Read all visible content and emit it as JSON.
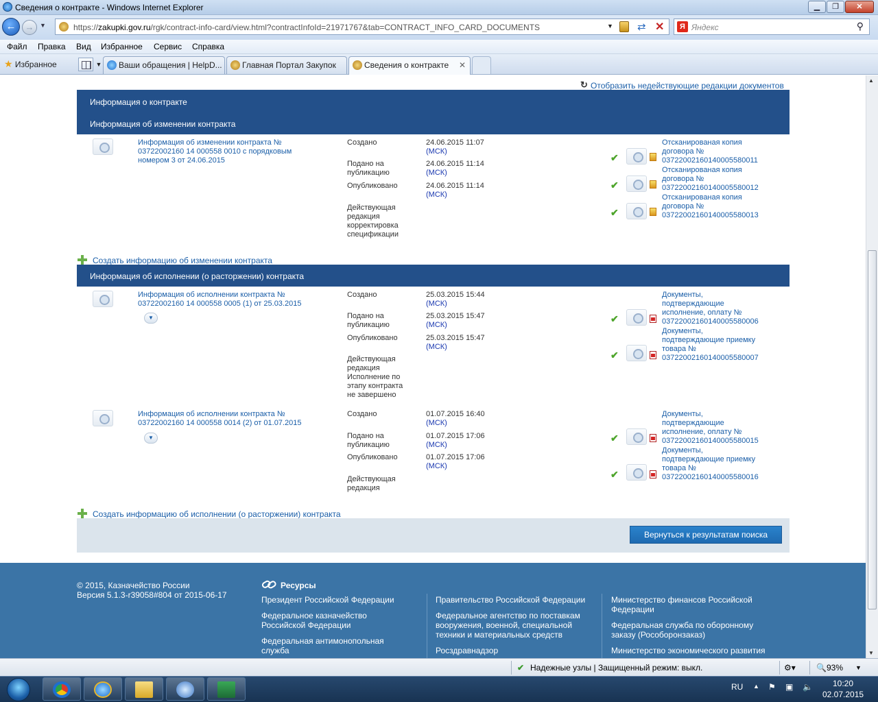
{
  "window": {
    "title": "Сведения о контракте - Windows Internet Explorer"
  },
  "nav": {
    "url_prefix": "https://",
    "url_host": "zakupki.gov.ru",
    "url_path": "/rgk/contract-info-card/view.html?contractInfoId=21971767&tab=CONTRACT_INFO_CARD_DOCUMENTS",
    "search_placeholder": "Яндекс",
    "search_logo": "Я"
  },
  "menu": [
    "Файл",
    "Правка",
    "Вид",
    "Избранное",
    "Сервис",
    "Справка"
  ],
  "favorites_label": "Избранное",
  "tabs": [
    {
      "label": "Ваши обращения | HelpD...",
      "active": false
    },
    {
      "label": "Главная Портал Закупок",
      "active": false
    },
    {
      "label": "Сведения о контракте",
      "active": true
    }
  ],
  "page": {
    "toggle_link": "Отобразить недействующие редакции документов",
    "sections": {
      "contract_info": "Информация о контракте",
      "changes": "Информация об изменении контракта",
      "execution": "Информация об исполнении (о расторжении) контракта"
    },
    "labels": {
      "created": "Создано",
      "submitted_l1": "Подано на",
      "submitted_l2": "публикацию",
      "published": "Опубликовано",
      "tz": "(МСК)"
    },
    "change_entry": {
      "title_l1": "Информация об изменении контракта №",
      "title_l2": "03722002160 14 000558 0010 с порядковым",
      "title_l3": "номером 3 от 24.06.2015",
      "created": "24.06.2015 11:07",
      "submitted": "24.06.2015 11:14",
      "published": "24.06.2015 11:14",
      "status_lines": [
        "Действующая",
        "редакция",
        "корректировка",
        "спецификации"
      ],
      "docs": [
        {
          "l1": "Отсканированая копия",
          "l2": "договора №",
          "l3": "03722002160140005580011"
        },
        {
          "l1": "Отсканированая копия",
          "l2": "договора №",
          "l3": "03722002160140005580012"
        },
        {
          "l1": "Отсканированая копия",
          "l2": "договора №",
          "l3": "03722002160140005580013"
        }
      ]
    },
    "create_change_link": "Создать информацию об изменении контракта",
    "exec_entries": [
      {
        "title_l1": "Информация об исполнении контракта №",
        "title_l2": "03722002160 14 000558 0005 (1) от 25.03.2015",
        "created": "25.03.2015 15:44",
        "submitted": "25.03.2015 15:47",
        "published": "25.03.2015 15:47",
        "status_lines": [
          "Действующая",
          "редакция",
          "Исполнение по",
          "этапу контракта",
          "не завершено"
        ],
        "docs": [
          {
            "l1": "Документы,",
            "l2": "подтверждающие",
            "l3": "исполнение, оплату №",
            "l4": "03722002160140005580006"
          },
          {
            "l1": "Документы,",
            "l2": "подтверждающие приемку",
            "l3": "товара №",
            "l4": "03722002160140005580007"
          }
        ]
      },
      {
        "title_l1": "Информация об исполнении контракта №",
        "title_l2": "03722002160 14 000558 0014 (2) от 01.07.2015",
        "created": "01.07.2015 16:40",
        "submitted": "01.07.2015 17:06",
        "published": "01.07.2015 17:06",
        "status_lines": [
          "Действующая",
          "редакция"
        ],
        "docs": [
          {
            "l1": "Документы,",
            "l2": "подтверждающие",
            "l3": "исполнение, оплату №",
            "l4": "03722002160140005580015"
          },
          {
            "l1": "Документы,",
            "l2": "подтверждающие приемку",
            "l3": "товара №",
            "l4": "03722002160140005580016"
          }
        ]
      }
    ],
    "create_exec_link": "Создать информацию об исполнении (о расторжении) контракта",
    "back_button": "Вернуться к результатам поиска"
  },
  "footer": {
    "copyright": "© 2015, Казначейство России",
    "version": "Версия 5.1.3-r39058#804 от 2015-06-17",
    "resources_title": "Ресурсы",
    "col1": [
      {
        "l1": "Президент Российской Федерации",
        "l2": ""
      },
      {
        "l1": "Федеральное казначейство",
        "l2": "Российской Федерации"
      },
      {
        "l1": "Федеральная антимонопольная",
        "l2": "служба"
      }
    ],
    "col2": [
      {
        "l1": "Правительство Российской Федерации",
        "l2": "",
        "l3": ""
      },
      {
        "l1": "Федеральное агентство по поставкам",
        "l2": "вооружения, военной, специальной",
        "l3": "техники и материальных средств"
      },
      {
        "l1": "Росздравнадзор",
        "l2": "",
        "l3": ""
      }
    ],
    "col3": [
      {
        "l1": "Министерство финансов Российской",
        "l2": "Федерации"
      },
      {
        "l1": "Федеральная служба по оборонному",
        "l2": "заказу (Рособоронзаказ)"
      },
      {
        "l1": "Министерство экономического развития",
        "l2": ""
      }
    ]
  },
  "status": {
    "zone": "Надежные узлы | Защищенный режим: выкл.",
    "zoom": "93%"
  },
  "tray": {
    "lang": "RU",
    "time": "10:20",
    "date": "02.07.2015"
  }
}
